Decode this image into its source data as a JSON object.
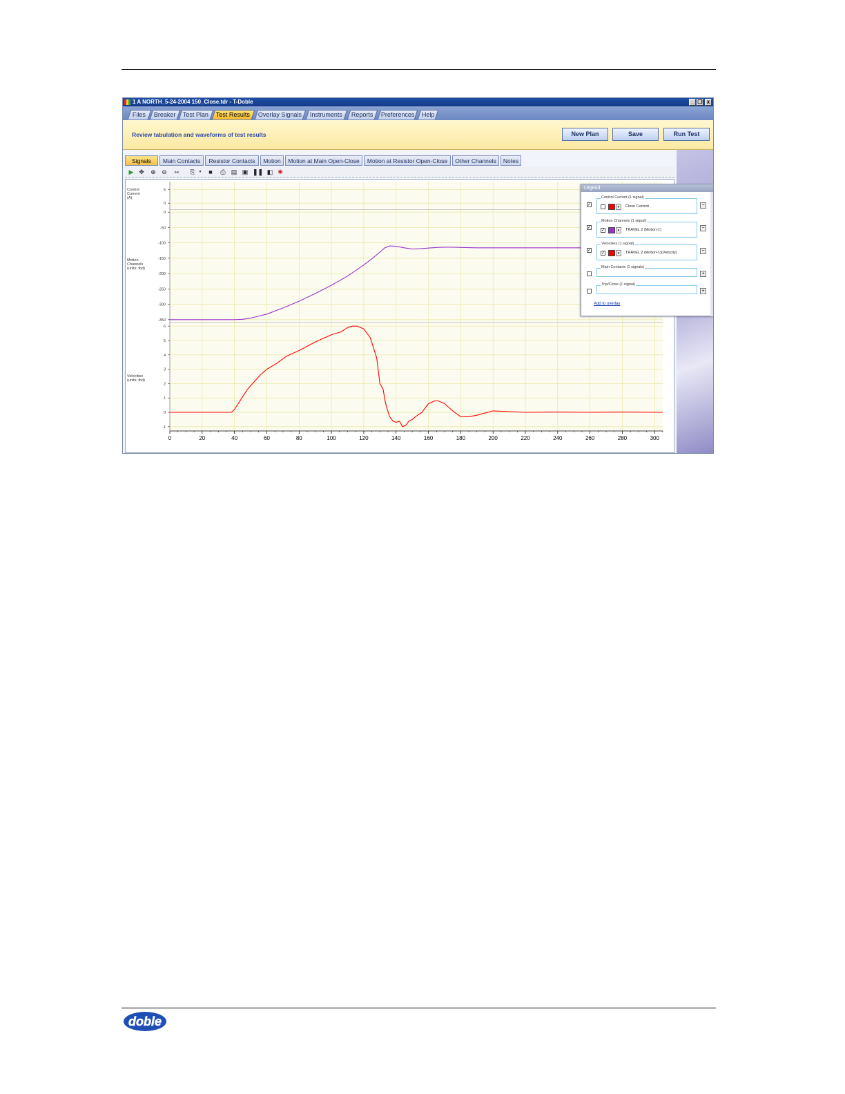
{
  "window": {
    "title": "1 A NORTH_5-24-2004 150_Close.tdr - T-Doble",
    "controls": {
      "minimize": "_",
      "restore": "❐",
      "close": "x"
    }
  },
  "main_tabs": [
    {
      "label": "Files"
    },
    {
      "label": "Breaker"
    },
    {
      "label": "Test Plan"
    },
    {
      "label": "Test Results",
      "active": true
    },
    {
      "label": "Overlay Signals"
    },
    {
      "label": "Instruments"
    },
    {
      "label": "Reports"
    },
    {
      "label": "Preferences"
    },
    {
      "label": "Help"
    }
  ],
  "banner": {
    "text": "Review tabulation and waveforms of test results",
    "buttons": {
      "new_plan": "New Plan",
      "save": "Save",
      "run_test": "Run Test"
    }
  },
  "sub_tabs": [
    {
      "label": "Signals",
      "active": true
    },
    {
      "label": "Main Contacts"
    },
    {
      "label": "Resistor Contacts"
    },
    {
      "label": "Motion"
    },
    {
      "label": "Motion at Main Open-Close"
    },
    {
      "label": "Motion at Resistor Open-Close"
    },
    {
      "label": "Other Channels"
    },
    {
      "label": "Notes"
    }
  ],
  "toolbar_icons": [
    "play-icon",
    "select-icon",
    "zoom-in-icon",
    "zoom-out-icon",
    "fit-icon",
    "copy-icon",
    "dropdown-icon",
    "save-icon",
    "print-icon",
    "print-preview-icon",
    "export-icon",
    "pause-icon",
    "properties-icon",
    "settings-icon"
  ],
  "axis_labels": {
    "control_current": "Control\nCurrent\n(A)",
    "motion_channels": "Motion\nChannels\n(units: tbd)",
    "velocities": "Velocities\n(units: tbd)"
  },
  "chart_data": {
    "type": "line",
    "x_ticks": [
      0,
      20,
      40,
      60,
      80,
      100,
      120,
      140,
      160,
      180,
      200,
      220,
      240,
      260,
      280,
      300
    ],
    "xlim": [
      0,
      305
    ],
    "grid": true,
    "panels": [
      {
        "name": "Control Current",
        "yticks": [
          5,
          0
        ],
        "ylim": [
          -2,
          8
        ],
        "series": []
      },
      {
        "name": "Motion Channels",
        "yticks": [
          0,
          -50,
          -100,
          -150,
          -200,
          -250,
          -300,
          -350
        ],
        "ylim": [
          -355,
          5
        ],
        "series": [
          {
            "name": "TRAVEL 2 (Motion-1)",
            "color": "#9932CC",
            "x": [
              0,
              20,
              40,
              45,
              50,
              60,
              70,
              80,
              90,
              100,
              110,
              120,
              125,
              130,
              133,
              136,
              140,
              145,
              150,
              155,
              160,
              165,
              170,
              175,
              180,
              190,
              200,
              220,
              240,
              260,
              280,
              305
            ],
            "y": [
              -350,
              -350,
              -350,
              -349,
              -345,
              -332,
              -312,
              -290,
              -265,
              -238,
              -208,
              -172,
              -152,
              -130,
              -116,
              -110,
              -111,
              -116,
              -120,
              -119,
              -117,
              -115,
              -114,
              -114,
              -115,
              -116,
              -116,
              -116,
              -116,
              -116,
              -116,
              -116
            ]
          }
        ]
      },
      {
        "name": "Velocities",
        "yticks": [
          6,
          5,
          4,
          3,
          2,
          1,
          0,
          -1
        ],
        "ylim": [
          -1.2,
          6.2
        ],
        "series": [
          {
            "name": "TRAVEL 2 (Motion-1)(Velocity)",
            "color": "#FF0000",
            "x": [
              0,
              38,
              40,
              44,
              48,
              52,
              56,
              60,
              66,
              72,
              80,
              90,
              100,
              106,
              110,
              113,
              116,
              120,
              124,
              128,
              130,
              132,
              133,
              134,
              136,
              138,
              140,
              142,
              144,
              146,
              148,
              150,
              152,
              156,
              160,
              164,
              166,
              170,
              175,
              180,
              185,
              190,
              200,
              210,
              220,
              240,
              260,
              280,
              305
            ],
            "y": [
              0,
              0,
              0.2,
              0.9,
              1.6,
              2.1,
              2.6,
              3.0,
              3.4,
              3.9,
              4.3,
              4.9,
              5.4,
              5.6,
              5.9,
              6.0,
              6.0,
              5.8,
              5.2,
              3.8,
              2.0,
              1.6,
              0.9,
              0.4,
              -0.3,
              -0.6,
              -0.7,
              -0.6,
              -1.0,
              -0.9,
              -0.6,
              -0.5,
              -0.3,
              0.0,
              0.6,
              0.8,
              0.8,
              0.6,
              0.1,
              -0.3,
              -0.3,
              -0.2,
              0.1,
              0.05,
              0,
              0.02,
              0,
              0.02,
              0
            ]
          }
        ]
      }
    ]
  },
  "legend": {
    "title": "Legend",
    "groups": [
      {
        "title": "Control Current (1 signal)",
        "signal": "Close Current",
        "color": "#FF0000",
        "group_checked": true,
        "signal_checked": false,
        "expand": "−"
      },
      {
        "title": "Motion Channels (1 signal)",
        "signal": "TRAVEL 2 (Motion-1)",
        "color": "#9932CC",
        "group_checked": true,
        "signal_checked": true,
        "expand": "−"
      },
      {
        "title": "Velocities (1 signal)",
        "signal": "TRAVEL 2 (Motion-1)(Velocity)",
        "color": "#FF0000",
        "group_checked": true,
        "signal_checked": true,
        "expand": "−"
      },
      {
        "title": "Main Contacts (1 signals)",
        "group_checked": false,
        "expand": "+"
      },
      {
        "title": "Trip/Close (1 signal)",
        "group_checked": false,
        "expand": "+"
      }
    ],
    "link": "Add to overlay"
  },
  "footer": {
    "logo": "doble",
    "logo_color": "#1f4fb5"
  }
}
